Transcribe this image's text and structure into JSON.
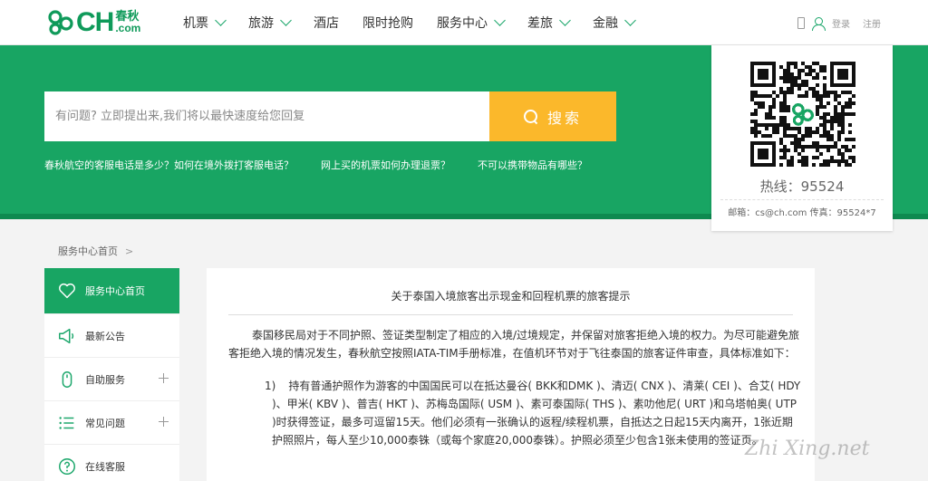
{
  "brand": {
    "cn": "春秋",
    "com": ".com",
    "ch": "CH"
  },
  "nav": {
    "items": [
      {
        "label": "机票",
        "dropdown": true
      },
      {
        "label": "旅游",
        "dropdown": true
      },
      {
        "label": "酒店",
        "dropdown": false
      },
      {
        "label": "限时抢购",
        "dropdown": false
      },
      {
        "label": "服务中心",
        "dropdown": true
      },
      {
        "label": "差旅",
        "dropdown": true
      },
      {
        "label": "金融",
        "dropdown": true
      }
    ],
    "login": "登录",
    "register": "注册"
  },
  "search": {
    "placeholder": "有问题? 立即提出来,我们将以最快速度给您回复",
    "button_label": "搜索"
  },
  "hot_questions": [
    "春秋航空的客服电话是多少？如何在境外拨打客服电话？",
    "网上买的机票如何办理退票？",
    "不可以携带物品有哪些？"
  ],
  "qr_card": {
    "hotline": "热线：95524",
    "contact": "邮箱：cs@ch.com  传真：95524*7"
  },
  "breadcrumb": {
    "home": "服务中心首页",
    "sep": ">"
  },
  "sidebar": {
    "items": [
      {
        "label": "服务中心首页",
        "icon": "heart-icon",
        "active": true,
        "expandable": false
      },
      {
        "label": "最新公告",
        "icon": "megaphone-icon",
        "active": false,
        "expandable": false
      },
      {
        "label": "自助服务",
        "icon": "mouse-icon",
        "active": false,
        "expandable": true
      },
      {
        "label": "常见问题",
        "icon": "list-icon",
        "active": false,
        "expandable": true
      },
      {
        "label": "在线客服",
        "icon": "question-icon",
        "active": false,
        "expandable": false
      }
    ]
  },
  "article": {
    "title": "关于泰国入境旅客出示现金和回程机票的旅客提示",
    "intro": "泰国移民局对于不同护照、签证类型制定了相应的入境/过境规定，并保留对旅客拒绝入境的权力。为尽可能避免旅客拒绝入境的情况发生，春秋航空按照IATA-TIM手册标准，在值机环节对于飞往泰国的旅客证件审查，具体标准如下：",
    "item1_num": "1)",
    "item1_text": "持有普通护照作为游客的中国国民可以在抵达曼谷( BKK和DMK )、清迈( CNX )、清莱( CEI )、合艾( HDY )、甲米( KBV )、普吉( HKT )、苏梅岛国际( USM )、素可泰国际( THS )、素叻他尼( URT )和乌塔帕奥( UTP )时获得签证，最多可逗留15天。他们必须有一张确认的返程/续程机票，自抵达之日起15天内离开，1张近期护照照片，每人至少10,000泰铢（或每个家庭20,000泰铢）。护照必须至少包含1张未使用的签证页。"
  },
  "watermark": "Zhi Xing.net",
  "colors": {
    "brand_green": "#18a563",
    "search_yellow": "#fbb82b"
  }
}
